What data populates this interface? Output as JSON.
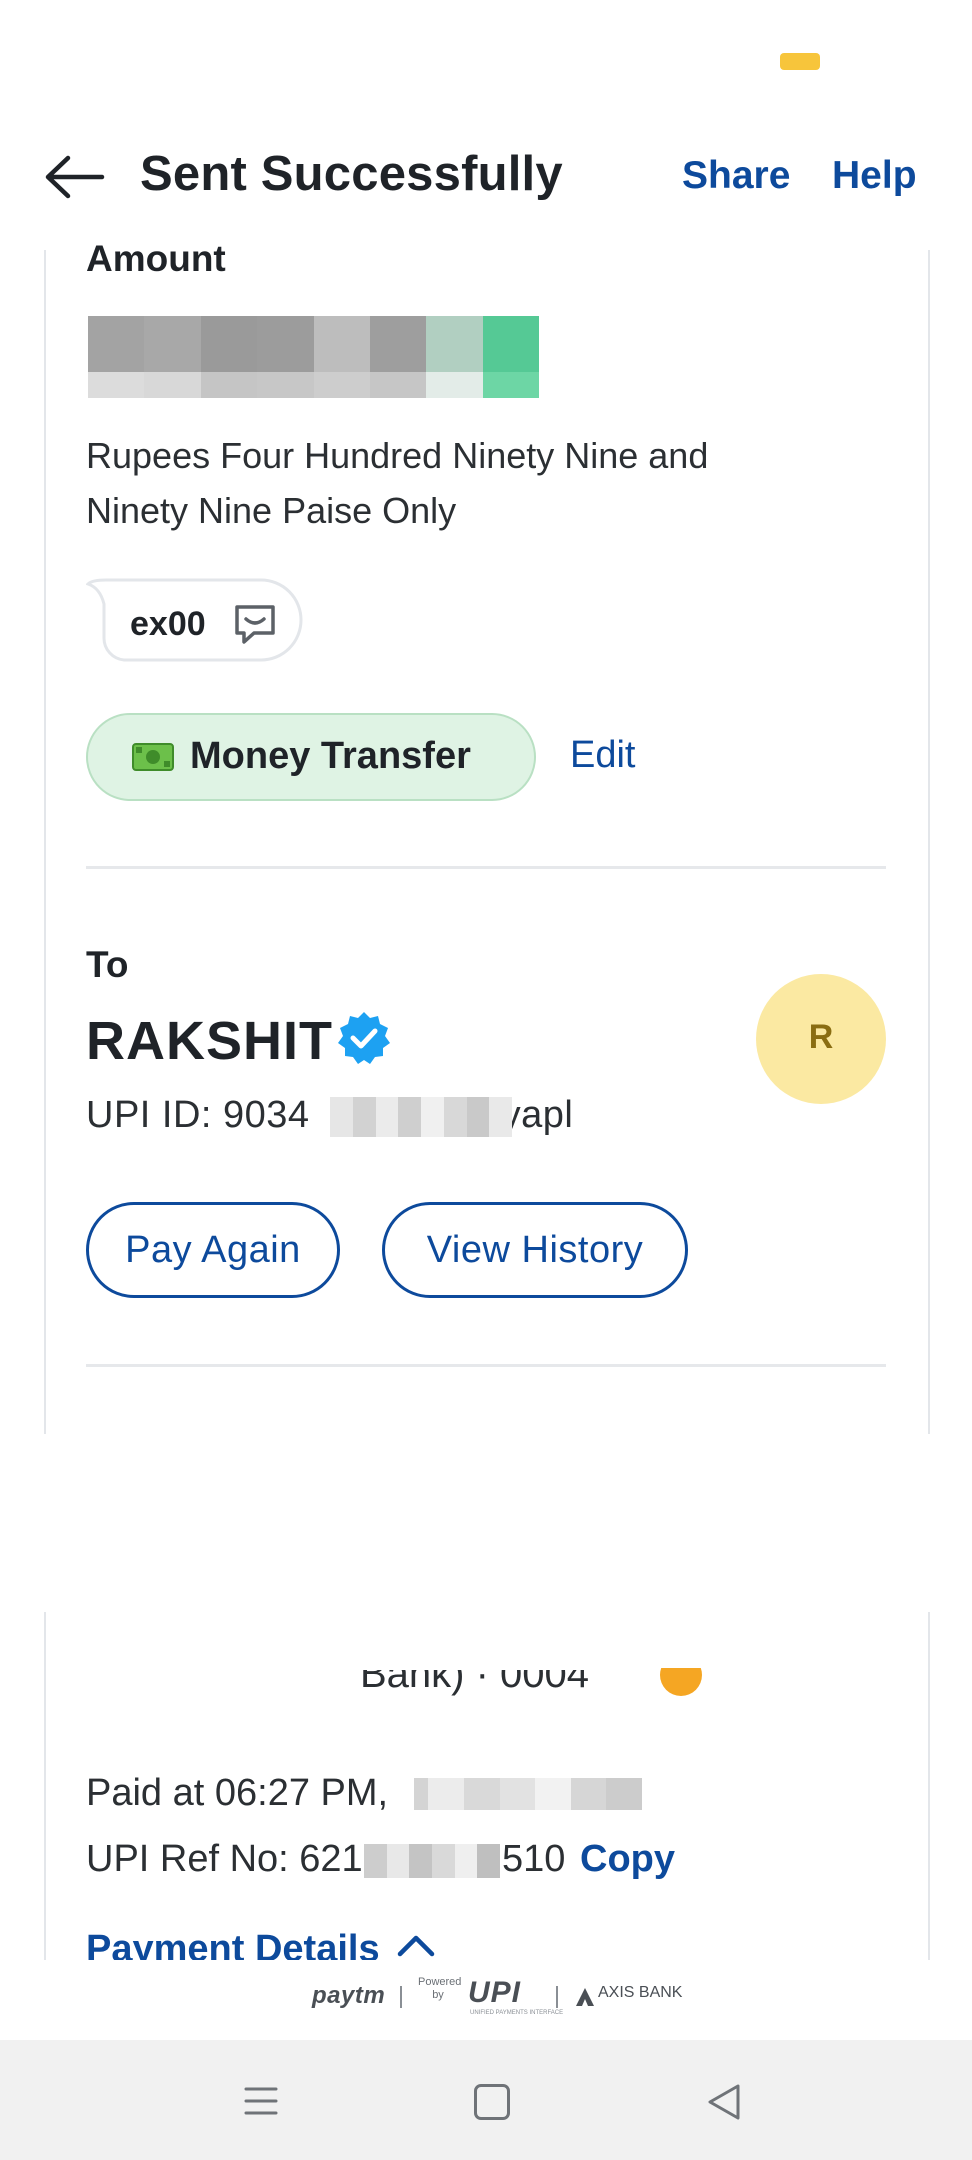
{
  "header": {
    "title": "Sent Successfully",
    "share_label": "Share",
    "help_label": "Help"
  },
  "amount": {
    "label": "Amount",
    "in_words": "Rupees Four Hundred Ninety Nine and Ninety Nine Paise Only"
  },
  "note": {
    "text": "ex00"
  },
  "category": {
    "emoji": "💵",
    "label": "Money Transfer",
    "edit_label": "Edit"
  },
  "payee": {
    "to_label": "To",
    "name": "RAKSHIT",
    "avatar_letter": "R",
    "upi_prefix": "UPI ID: 9034",
    "upi_suffix": "yapl"
  },
  "actions": {
    "pay_again": "Pay Again",
    "view_history": "View History"
  },
  "source_account": {
    "bank_text": "Bank) · 0004"
  },
  "transaction": {
    "paid_at": "Paid at 06:27 PM,",
    "upi_ref_prefix": "UPI Ref No: 621",
    "upi_ref_suffix": "510",
    "copy_label": "Copy",
    "payment_details_label": "Payment Details"
  },
  "footer": {
    "paytm": "paytm",
    "powered_by": "Powered by",
    "upi": "UPI",
    "upi_sub": "UNIFIED PAYMENTS INTERFACE",
    "axis_bank": "AXIS BANK"
  },
  "colors": {
    "accent": "#0d4a9c",
    "chip_bg": "#dff3e4",
    "avatar_bg": "#fbe9a2",
    "verified": "#1da1f2"
  }
}
